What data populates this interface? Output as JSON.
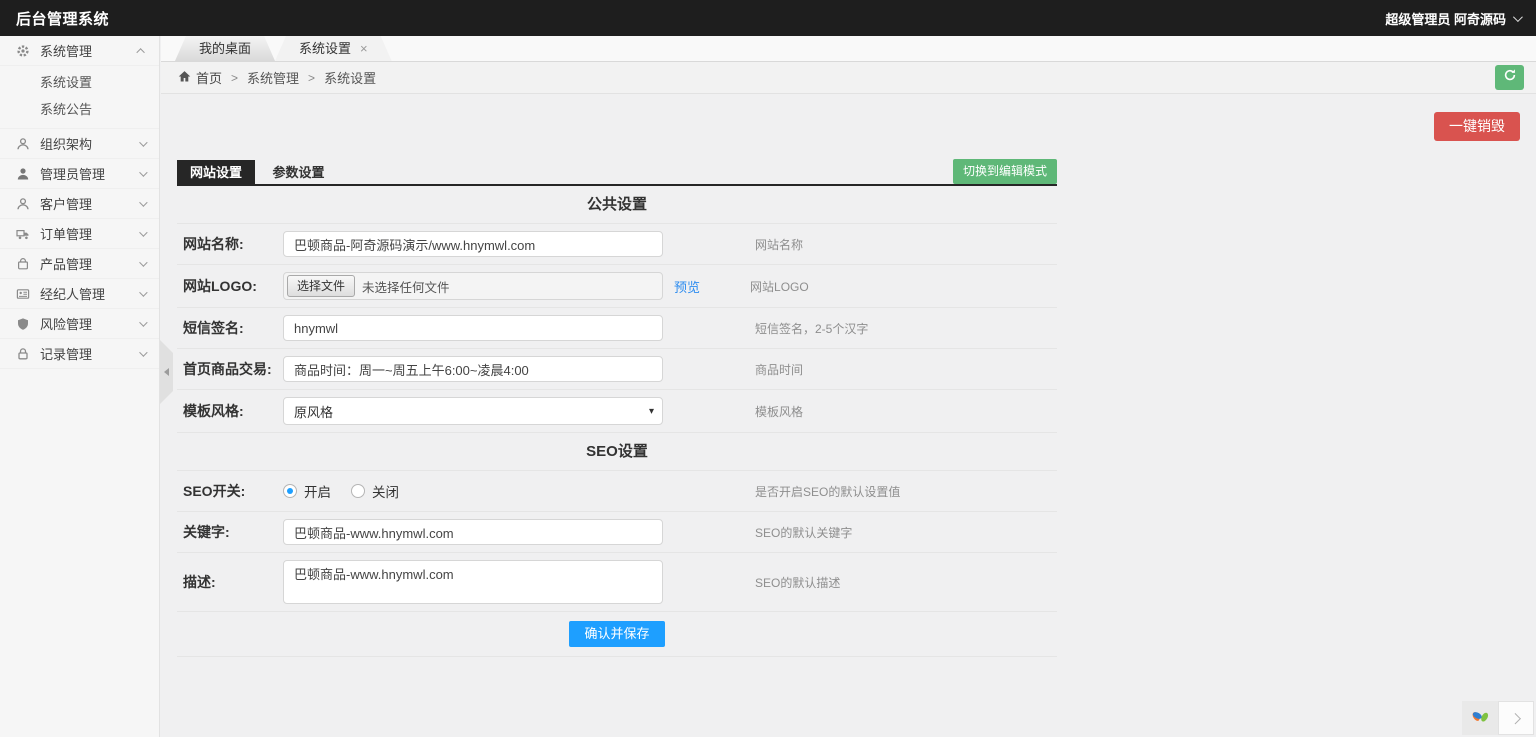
{
  "topbar": {
    "title": "后台管理系统",
    "user": "超级管理员 阿奇源码"
  },
  "sidebar": {
    "groups": [
      {
        "label": "系统管理",
        "children": [
          {
            "label": "系统设置"
          },
          {
            "label": "系统公告"
          }
        ]
      },
      {
        "label": "组织架构"
      },
      {
        "label": "管理员管理"
      },
      {
        "label": "客户管理"
      },
      {
        "label": "订单管理"
      },
      {
        "label": "产品管理"
      },
      {
        "label": "经纪人管理"
      },
      {
        "label": "风险管理"
      },
      {
        "label": "记录管理"
      }
    ]
  },
  "window_tabs": [
    {
      "label": "我的桌面"
    },
    {
      "label": "系统设置"
    }
  ],
  "icons": {
    "close": "×",
    "caret": "▾"
  },
  "breadcrumb": {
    "home": "首页",
    "separator": ">",
    "level1": "系统管理",
    "level2": "系统设置"
  },
  "toolbar": {
    "destroy_label": "一键销毁"
  },
  "panel": {
    "tabs": [
      {
        "label": "网站设置"
      },
      {
        "label": "参数设置"
      }
    ],
    "edit_mode_label": "切换到编辑模式",
    "section_common": "公共设置",
    "section_seo": "SEO设置",
    "save_label": "确认并保存",
    "fields": {
      "site_name": {
        "label": "网站名称:",
        "value": "巴顿商品-阿奇源码演示/www.hnymwl.com",
        "desc": "网站名称"
      },
      "site_logo": {
        "label": "网站LOGO:",
        "choose_label": "选择文件",
        "status": "未选择任何文件",
        "preview_label": "预览",
        "desc": "网站LOGO"
      },
      "sms_sign": {
        "label": "短信签名:",
        "value": "hnymwl",
        "desc": "短信签名，2-5个汉字"
      },
      "home_trade": {
        "label": "首页商品交易:",
        "value": "商品时间：周一~周五上午6:00~凌晨4:00",
        "desc": "商品时间"
      },
      "template": {
        "label": "模板风格:",
        "value": "原风格",
        "desc": "模板风格"
      },
      "seo_switch": {
        "label": "SEO开关:",
        "option_on": "开启",
        "option_off": "关闭",
        "desc": "是否开启SEO的默认设置值"
      },
      "keywords": {
        "label": "关键字:",
        "value": "巴顿商品-www.hnymwl.com",
        "desc": "SEO的默认关键字"
      },
      "description": {
        "label": "描述:",
        "value": "巴顿商品-www.hnymwl.com",
        "desc": "SEO的默认描述"
      }
    }
  }
}
